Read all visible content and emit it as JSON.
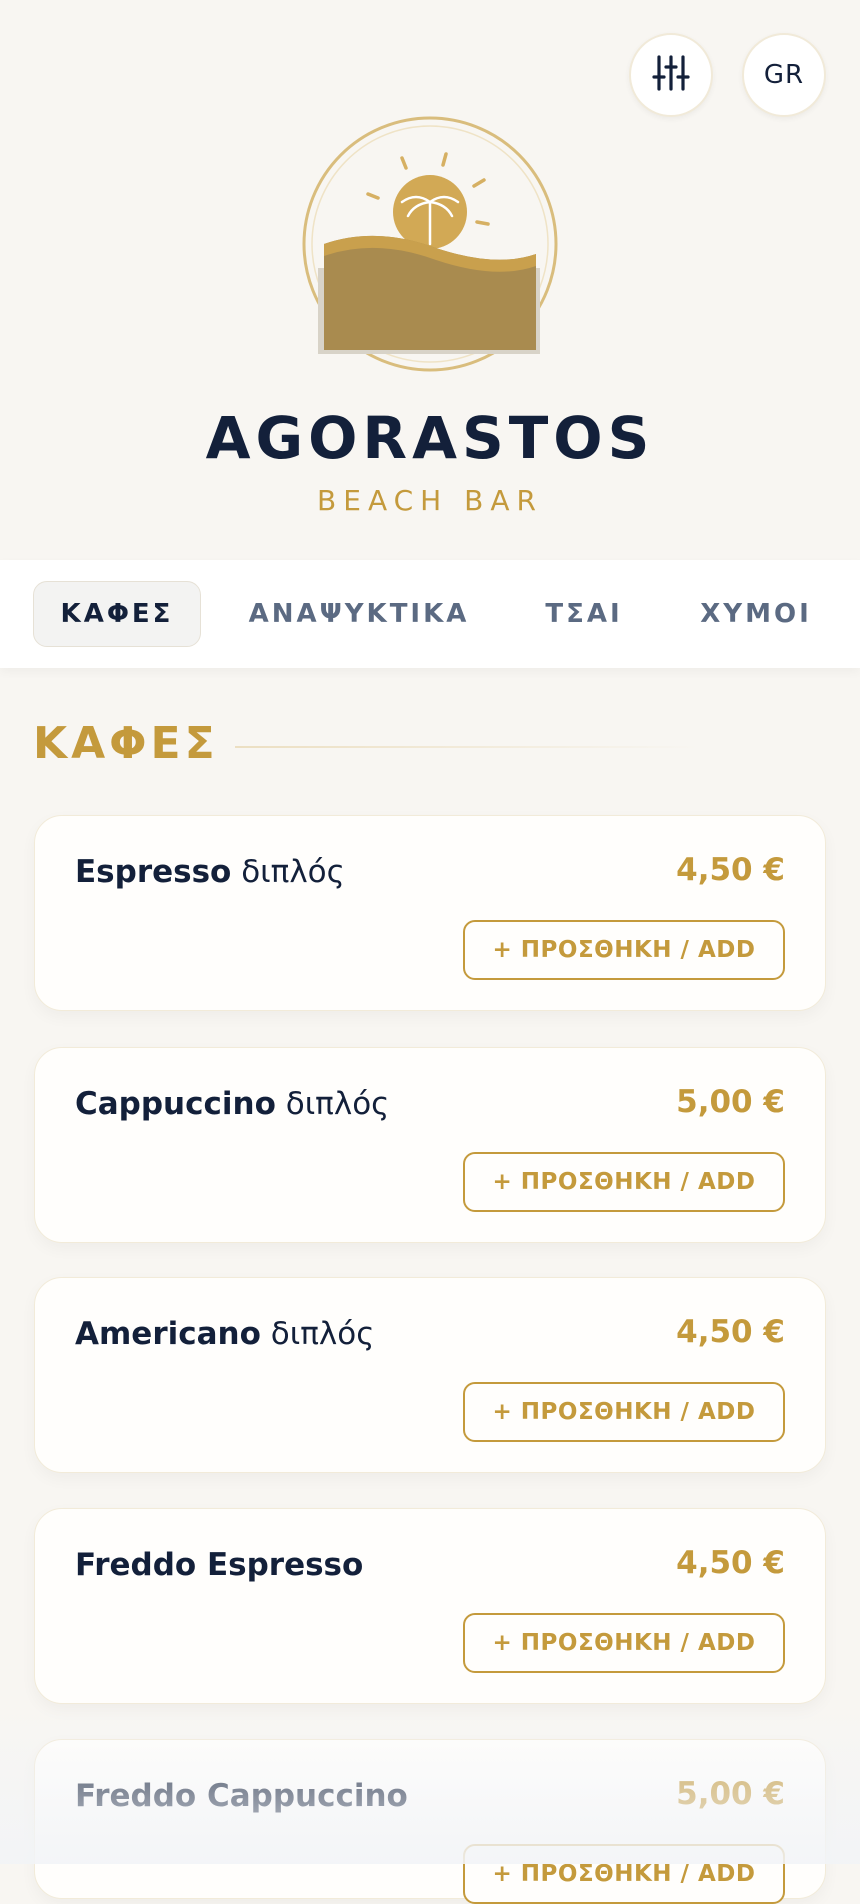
{
  "header": {
    "language_label": "GR",
    "filter_icon": "sliders-icon",
    "brand_name": "AGORASTOS",
    "brand_subtitle": "BEACH BAR"
  },
  "colors": {
    "accent": "#c49a3c",
    "navy": "#13203a",
    "background": "#f8f6f2",
    "tab_muted": "#5b6a82"
  },
  "tabs": [
    {
      "label": "ΚΑΦΕΣ",
      "active": true
    },
    {
      "label": "ΑΝΑΨΥΚΤΙΚΑ",
      "active": false
    },
    {
      "label": "ΤΣΑΙ",
      "active": false
    },
    {
      "label": "ΧΥΜΟΙ",
      "active": false
    }
  ],
  "section": {
    "title": "ΚΑΦΕΣ"
  },
  "items": [
    {
      "name_main": "Espresso",
      "name_extra": " διπλός",
      "price": "4,50 €",
      "button": "+ ΠΡΟΣΘΗΚΗ / ADD"
    },
    {
      "name_main": "Cappuccino",
      "name_extra": " διπλός",
      "price": "5,00 €",
      "button": "+ ΠΡΟΣΘΗΚΗ / ADD"
    },
    {
      "name_main": "Americano",
      "name_extra": " διπλός",
      "price": "4,50 €",
      "button": "+ ΠΡΟΣΘΗΚΗ / ADD"
    },
    {
      "name_main": "Freddo Espresso",
      "name_extra": "",
      "price": "4,50 €",
      "button": "+ ΠΡΟΣΘΗΚΗ / ADD"
    },
    {
      "name_main": "Freddo Cappuccino",
      "name_extra": "",
      "price": "5,00 €",
      "button": "+ ΠΡΟΣΘΗΚΗ / ADD"
    }
  ]
}
